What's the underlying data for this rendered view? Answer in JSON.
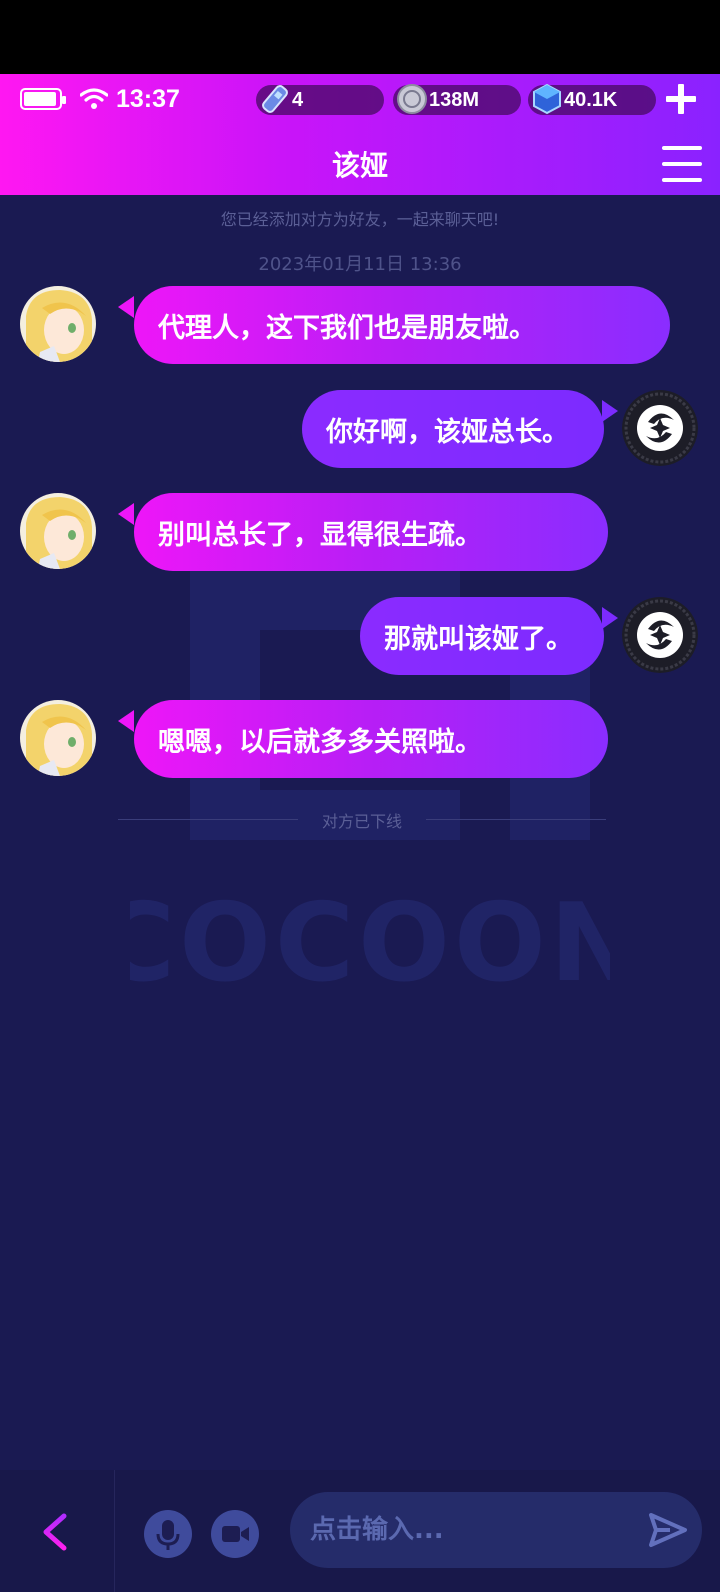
{
  "status_bar": {
    "time": "13:37"
  },
  "resources": {
    "energy": "4",
    "coins": "138M",
    "gems": "40.1K"
  },
  "header": {
    "title": "该娅"
  },
  "chat": {
    "friend_note": "您已经添加对方为好友，一起来聊天吧!",
    "timestamp": "2023年01月11日 13:36",
    "offline_note": "对方已下线",
    "messages": [
      {
        "side": "left",
        "text": "代理人，这下我们也是朋友啦。"
      },
      {
        "side": "right",
        "text": "你好啊，该娅总长。"
      },
      {
        "side": "left",
        "text": "别叫总长了，显得很生疏。"
      },
      {
        "side": "right",
        "text": "那就叫该娅了。"
      },
      {
        "side": "left",
        "text": "嗯嗯，以后就多多关照啦。"
      }
    ]
  },
  "watermark": {
    "text": "COCOON"
  },
  "input": {
    "placeholder": "点击输入..."
  },
  "colors": {
    "header_start": "#ff17f2",
    "header_end": "#8a22ff",
    "background": "#1a1a52",
    "bubble_right": "#7c2bff"
  },
  "icons": [
    "battery-icon",
    "wifi-icon",
    "energy-icon",
    "coin-icon",
    "gem-icon",
    "plus-icon",
    "menu-icon",
    "back-icon",
    "mic-icon",
    "camera-icon",
    "send-icon"
  ]
}
